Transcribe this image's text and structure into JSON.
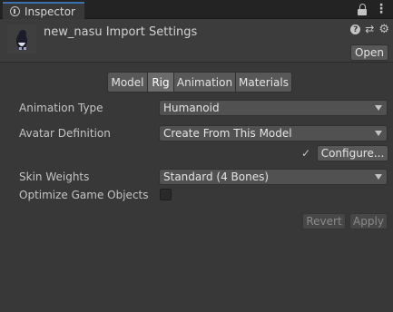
{
  "tab": {
    "title": "Inspector",
    "icon": "info-icon"
  },
  "tabbar_icons": [
    "lock-icon",
    "kebab-menu-icon"
  ],
  "header": {
    "title": "new_nasu Import Settings",
    "open_label": "Open",
    "icons": [
      "help-icon",
      "preset-icon",
      "gear-icon"
    ]
  },
  "segment": {
    "items": [
      {
        "label": "Model",
        "active": false
      },
      {
        "label": "Rig",
        "active": true
      },
      {
        "label": "Animation",
        "active": false
      },
      {
        "label": "Materials",
        "active": false
      }
    ]
  },
  "fields": {
    "animation_type": {
      "label": "Animation Type",
      "value": "Humanoid"
    },
    "avatar_definition": {
      "label": "Avatar Definition",
      "value": "Create From This Model"
    },
    "configure": {
      "check": "✓",
      "label": "Configure..."
    },
    "skin_weights": {
      "label": "Skin Weights",
      "value": "Standard (4 Bones)"
    },
    "optimize": {
      "label": "Optimize Game Objects",
      "checked": false
    }
  },
  "footer": {
    "revert_label": "Revert",
    "apply_label": "Apply"
  }
}
